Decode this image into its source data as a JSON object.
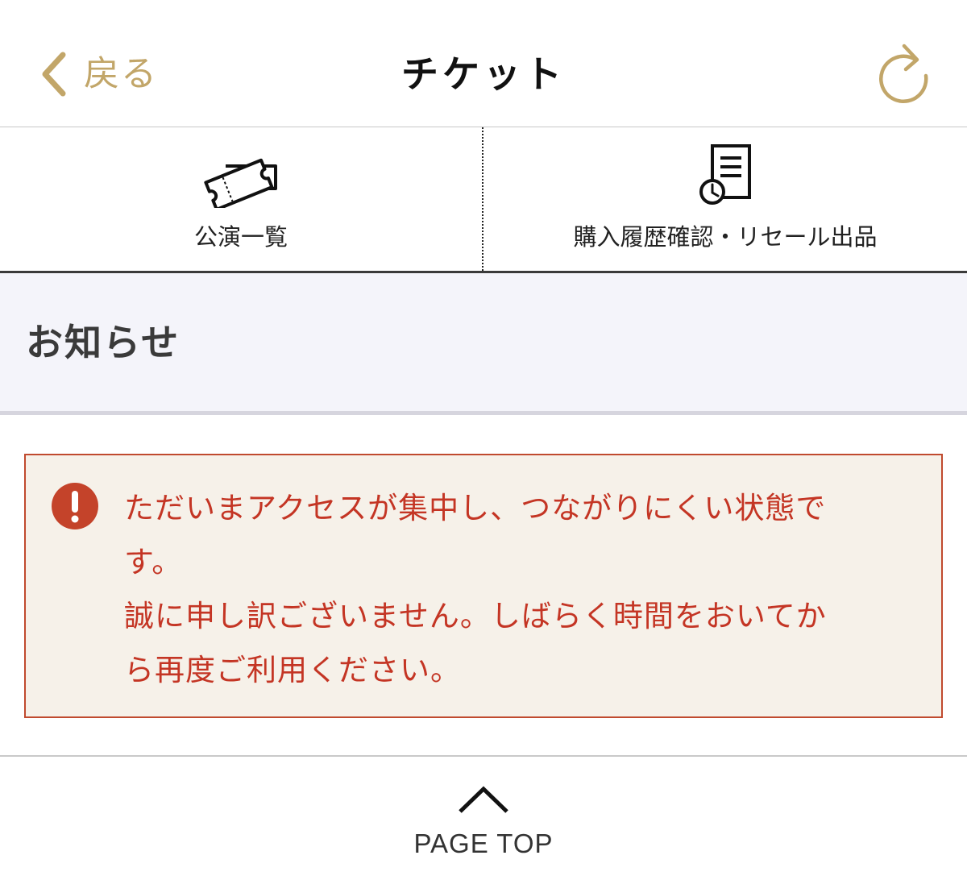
{
  "header": {
    "back_label": "戻る",
    "title": "チケット",
    "reload_icon": "reload-icon",
    "back_icon": "chevron-left-icon"
  },
  "tabs": [
    {
      "label": "公演一覧",
      "icon": "ticket-icon"
    },
    {
      "label": "購入履歴確認・リセール出品",
      "icon": "receipt-clock-icon"
    }
  ],
  "notice": {
    "title": "お知らせ",
    "alert_icon": "exclamation-circle-icon",
    "message_lines": [
      "ただいまアクセスが集中し、つながりにくい状態で",
      "す。",
      "誠に申し訳ございません。しばらく時間をおいてか",
      "ら再度ご利用ください。"
    ]
  },
  "footer": {
    "page_top_label": "PAGE TOP",
    "page_top_icon": "chevron-up-icon"
  },
  "colors": {
    "accent_gold": "#c2a669",
    "alert_red": "#c43524",
    "alert_border": "#c04a2e",
    "alert_background": "#f6f1e9",
    "notice_background": "#f4f4fa"
  }
}
